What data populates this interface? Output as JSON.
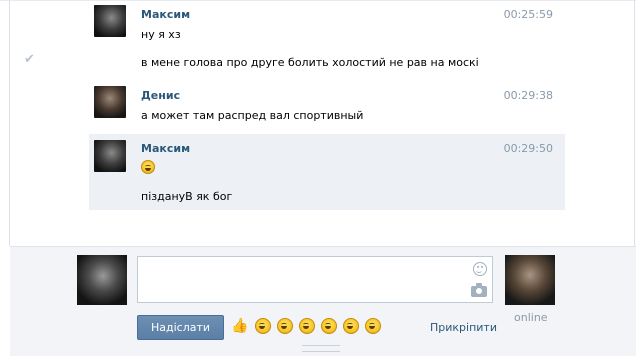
{
  "messages": [
    {
      "author": "Максим",
      "time": "00:25:59",
      "lines": [
        "ну я хз",
        "в мене голова про друге болить холостий не рав на москі"
      ]
    },
    {
      "author": "Денис",
      "time": "00:29:38",
      "lines": [
        "а может там распред вал спортивный"
      ]
    },
    {
      "author": "Максим",
      "time": "00:29:50",
      "emoji": "laughing-emoji",
      "lines": [
        "піздануВ як бог"
      ]
    }
  ],
  "composer": {
    "send_label": "Надіслати",
    "attach_label": "Прикріпити",
    "peer_status": "online",
    "quick_emojis": [
      "thumbs-up",
      "confused",
      "laughing",
      "blushing",
      "winking",
      "shocked",
      "smiling"
    ]
  },
  "colors": {
    "link": "#2b587a",
    "highlight": "#edf1f5",
    "button": "#5b7fa6"
  }
}
